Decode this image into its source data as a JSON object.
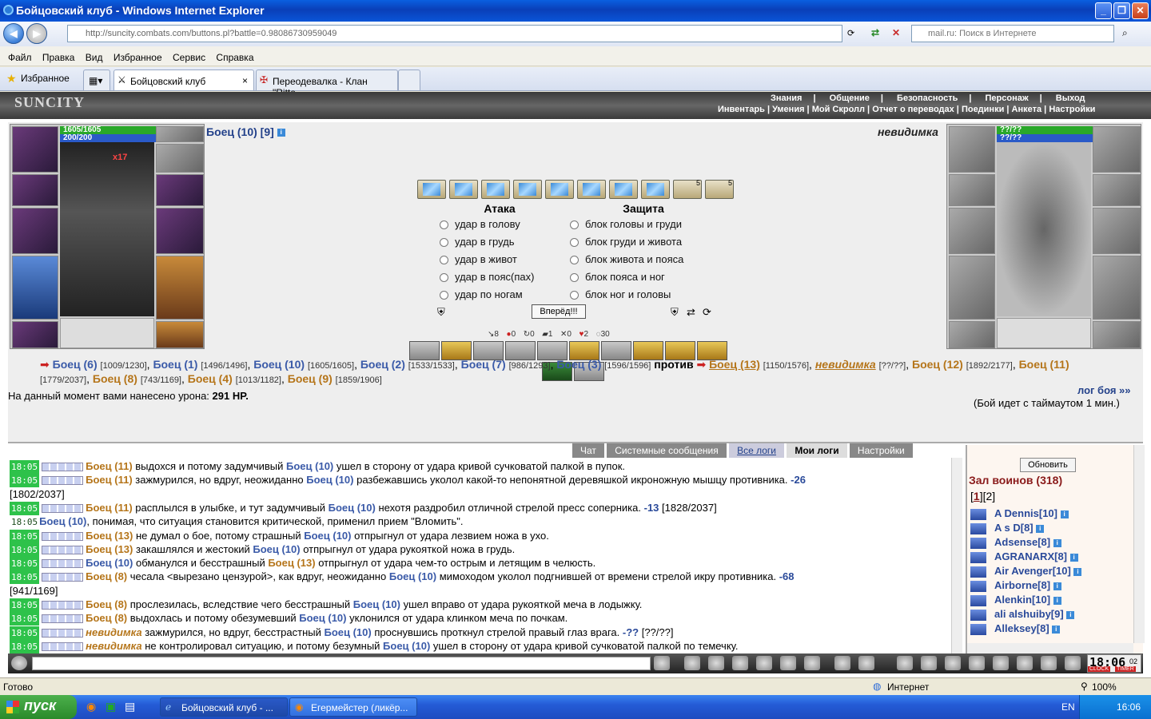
{
  "window": {
    "title": "Бойцовский клуб - Windows Internet Explorer"
  },
  "browser": {
    "url": "http://suncity.combats.com/buttons.pl?battle=0.98086730959049",
    "search_placeholder": "mail.ru: Поиск в Интернете",
    "menu": [
      "Файл",
      "Правка",
      "Вид",
      "Избранное",
      "Сервис",
      "Справка"
    ],
    "favorites_label": "Избранное",
    "tabs": [
      "Бойцовский клуб",
      "Переодевалка - Клан \"Ritte..."
    ]
  },
  "site": {
    "logo": "SUNCITY",
    "menu_top": [
      "Знания",
      "Общение",
      "Безопасность",
      "Персонаж",
      "Выход"
    ],
    "menu_sub": [
      "Инвентарь",
      "Умения",
      "Мой Скролл",
      "Отчет о переводах",
      "Поединки",
      "Анкета",
      "Настройки"
    ]
  },
  "player": {
    "name": "Боец (10) [9]",
    "hp": "1605/1605",
    "mana": "200/200",
    "badge": "x17"
  },
  "enemy": {
    "name": "невидимка",
    "hp": "??/??",
    "mana": "??/??"
  },
  "attack": {
    "header": "Атака",
    "options": [
      "удар в голову",
      "удар в грудь",
      "удар в живот",
      "удар в пояс(пах)",
      "удар по ногам"
    ]
  },
  "defense": {
    "header": "Защита",
    "options": [
      "блок головы и груди",
      "блок груди и живота",
      "блок живота и пояса",
      "блок пояса и ног",
      "блок ног и головы"
    ]
  },
  "forward_button": "Вперёд!!!",
  "scroll_counts": [
    "5",
    "5"
  ],
  "stats": [
    "8",
    "0",
    "0",
    "1",
    "0",
    "2",
    "30"
  ],
  "teams": {
    "left": [
      {
        "name": "Боец (6)",
        "hp": "[1009/1230]"
      },
      {
        "name": "Боец (1)",
        "hp": "[1496/1496]"
      },
      {
        "name": "Боец (10)",
        "hp": "[1605/1605]"
      },
      {
        "name": "Боец (2)",
        "hp": "[1533/1533]"
      },
      {
        "name": "Боец (7)",
        "hp": "[986/1293]"
      },
      {
        "name": "Боец (3)",
        "hp": "[1596/1596]"
      }
    ],
    "vs": "против",
    "right": [
      {
        "name": "Боец (13)",
        "hp": "[1150/1576]"
      },
      {
        "name": "невидимка",
        "hp": "[??/??]"
      },
      {
        "name": "Боец (12)",
        "hp": "[1892/2177]"
      },
      {
        "name": "Боец (11)",
        "hp": "[1779/2037]"
      },
      {
        "name": "Боец (8)",
        "hp": "[743/1169]"
      },
      {
        "name": "Боец (4)",
        "hp": "[1013/1182]"
      },
      {
        "name": "Боец (9)",
        "hp": "[1859/1906]"
      }
    ]
  },
  "damage_text": "На данный момент вами нанесено урона:",
  "damage_value": "291 HP.",
  "battle_log_link": "лог боя »»",
  "timeout_text": "(Бой идет с таймаутом 1 мин.)",
  "chat_tabs": [
    "Чат",
    "Системные сообщения",
    "Все логи",
    "Мои логи",
    "Настройки"
  ],
  "logs": [
    {
      "time": "18:05",
      "a": "Боец (11)",
      "t1": " выдохся и потому задумчивый ",
      "b": "Боец (10)",
      "t2": " ушел в сторону от удара кривой сучковатой палкой в пупок.",
      "dmg": "",
      "hp": ""
    },
    {
      "time": "18:05",
      "a": "Боец (11)",
      "t1": " зажмурился, но вдруг, неожиданно ",
      "b": "Боец (10)",
      "t2": " разбежавшись уколол какой-то непонятной деревяшкой икроножную мышцу противника.",
      "dmg": " -26",
      "hp": ""
    },
    {
      "time": "",
      "a": "",
      "t1": "[1802/2037]",
      "b": "",
      "t2": "",
      "dmg": "",
      "hp": ""
    },
    {
      "time": "18:05",
      "a": "Боец (11)",
      "t1": " расплылся в улыбке, и тут задумчивый ",
      "b": "Боец (10)",
      "t2": " нехотя раздробил отличной стрелой пресс соперника.",
      "dmg": " -13",
      "hp": " [1828/2037]"
    },
    {
      "time": "18:05",
      "a": "",
      "t1": "",
      "b": "Боец (10)",
      "t2": ", понимая, что ситуация становится критической, применил прием \"Вломить\".",
      "dmg": "",
      "hp": ""
    },
    {
      "time": "18:05",
      "a": "Боец (13)",
      "t1": " не думал о бое, потому страшный ",
      "b": "Боец (10)",
      "t2": " отпрыгнул от удара лезвием ножа в ухо.",
      "dmg": "",
      "hp": ""
    },
    {
      "time": "18:05",
      "a": "Боец (13)",
      "t1": " закашлялся и жестокий ",
      "b": "Боец (10)",
      "t2": " отпрыгнул от удара рукояткой ножа в грудь.",
      "dmg": "",
      "hp": ""
    },
    {
      "time": "18:05",
      "a": "Боец (10)",
      "t1": " обманулся и бесстрашный ",
      "b": "Боец (13)",
      "t2": " отпрыгнул от удара чем-то острым и летящим в челюсть.",
      "dmg": "",
      "hp": ""
    },
    {
      "time": "18:05",
      "a": "Боец (8)",
      "t1": " чесала <вырезано цензурой>, как вдруг, неожиданно ",
      "b": "Боец (10)",
      "t2": " мимоходом уколол подгнившей от времени стрелой икру противника.",
      "dmg": " -68",
      "hp": ""
    },
    {
      "time": "",
      "a": "",
      "t1": "[941/1169]",
      "b": "",
      "t2": "",
      "dmg": "",
      "hp": ""
    },
    {
      "time": "18:05",
      "a": "Боец (8)",
      "t1": " прослезилась, вследствие чего бесстрашный ",
      "b": "Боец (10)",
      "t2": " ушел вправо от удара рукояткой меча в лодыжку.",
      "dmg": "",
      "hp": ""
    },
    {
      "time": "18:05",
      "a": "Боец (8)",
      "t1": " выдохлась и потому обезумевший ",
      "b": "Боец (10)",
      "t2": " уклонился от удара клинком меча по почкам.",
      "dmg": "",
      "hp": ""
    },
    {
      "time": "18:05",
      "a": "невидимка",
      "t1": " зажмурился, но вдруг, бесстрастный ",
      "b": "Боец (10)",
      "t2": " проснувшись проткнул стрелой правый глаз врага.",
      "dmg": " -??",
      "hp": " [??/??]"
    },
    {
      "time": "18:05",
      "a": "невидимка",
      "t1": " не контролировал ситуацию, и потому безумный ",
      "b": "Боец (10)",
      "t2": " ушел в сторону от удара кривой сучковатой палкой по темечку.",
      "dmg": "",
      "hp": ""
    }
  ],
  "sidebar": {
    "refresh_button": "Обновить",
    "hall_title": "Зал воинов (318)",
    "pages": [
      "1",
      "2"
    ],
    "warriors": [
      "A Dennis[10]",
      "A s D[8]",
      "Adsense[8]",
      "AGRANARX[8]",
      "Air Avenger[10]",
      "Airborne[8]",
      "Alenkin[10]",
      "ali alshuiby[9]",
      "Alleksey[8]"
    ]
  },
  "clock": "18:06",
  "clock_sec": "02",
  "clock_labels": [
    "CLOCK",
    "TIMER"
  ],
  "statusbar": {
    "status": "Готово",
    "zone": "Интернет",
    "zoom": "100%"
  },
  "taskbar": {
    "start": "пуск",
    "tasks": [
      "Бойцовский клуб - ...",
      "Егермейстер (ликёр..."
    ],
    "lang": "EN",
    "time": "16:06"
  }
}
